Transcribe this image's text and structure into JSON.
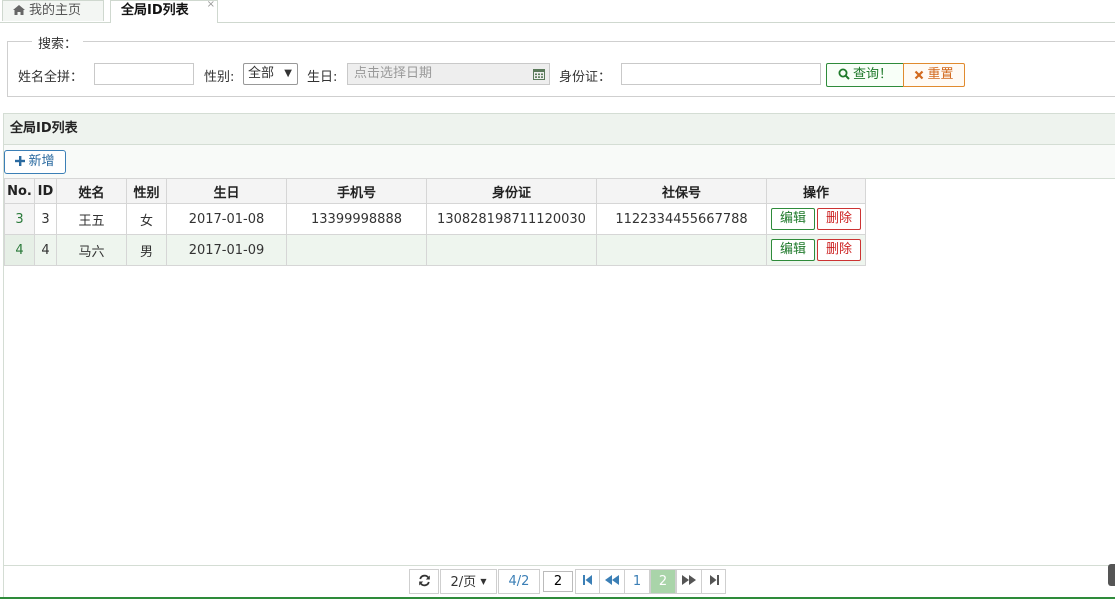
{
  "tabs": {
    "home_label": "我的主页",
    "active_label": "全局ID列表",
    "close_glyph": "×"
  },
  "search": {
    "legend": "搜索：",
    "name_label": "姓名全拼：",
    "name_value": "",
    "gender_label": "性别:",
    "gender_selected": "全部",
    "birthday_label": "生日:",
    "birthday_placeholder": "点击选择日期",
    "idcard_label": "身份证：",
    "idcard_value": "",
    "query_button": "查询！",
    "reset_button": "重置"
  },
  "panel": {
    "title": "全局ID列表",
    "add_button": "新增"
  },
  "table": {
    "headers": [
      "No.",
      "ID",
      "姓名",
      "性别",
      "生日",
      "手机号",
      "身份证",
      "社保号",
      "操作"
    ],
    "rows": [
      {
        "no": "3",
        "id": "3",
        "name": "王五",
        "gender": "女",
        "birthday": "2017-01-08",
        "phone": "13399998888",
        "idcard": "130828198711120030",
        "social": "1122334455667788"
      },
      {
        "no": "4",
        "id": "4",
        "name": "马六",
        "gender": "男",
        "birthday": "2017-01-09",
        "phone": "",
        "idcard": "",
        "social": ""
      }
    ],
    "edit_label": "编辑",
    "delete_label": "删除"
  },
  "pager": {
    "page_size": "2/页",
    "page_info": "4/2",
    "page_input": "2",
    "pages": [
      "1",
      "2"
    ],
    "current_page": "2"
  },
  "colors": {
    "accent_green": "#2e8b3a",
    "accent_blue": "#3b7fb6",
    "danger_red": "#cc2222",
    "reset_orange": "#d2691e"
  }
}
